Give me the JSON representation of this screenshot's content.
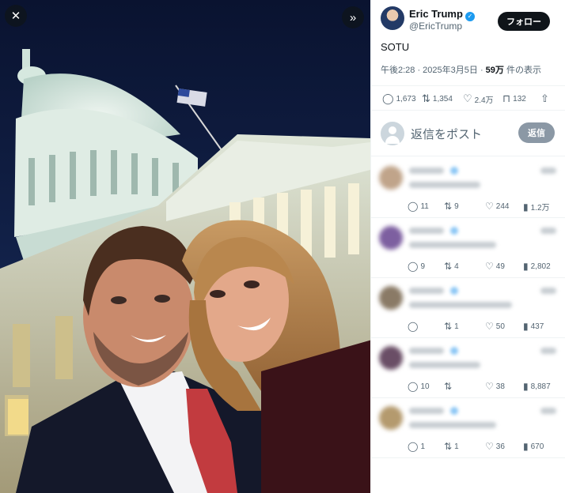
{
  "viewer": {
    "close_icon": "close-icon",
    "expand_icon": "double-chevron-right-icon"
  },
  "author": {
    "name": "Eric Trump",
    "handle": "@EricTrump",
    "verified": true,
    "follow_label": "フォロー"
  },
  "tweet": {
    "text": "SOTU",
    "timestamp": "午後2:28 · 2025年3月5日 · ",
    "views_count": "59万",
    "views_suffix": " 件の表示"
  },
  "actions": {
    "replies": "1,673",
    "reposts": "1,354",
    "likes": "2.4万",
    "bookmarks": "132"
  },
  "compose": {
    "placeholder": "返信をポスト",
    "reply_label": "返信"
  },
  "replies": [
    {
      "replies": "11",
      "reposts": "9",
      "likes": "244",
      "views": "1.2万"
    },
    {
      "replies": "9",
      "reposts": "4",
      "likes": "49",
      "views": "2,802"
    },
    {
      "replies": "",
      "reposts": "1",
      "likes": "50",
      "views": "437"
    },
    {
      "replies": "10",
      "reposts": "",
      "likes": "38",
      "views": "8,887"
    },
    {
      "replies": "1",
      "reposts": "1",
      "likes": "36",
      "views": "670"
    }
  ],
  "colors": {
    "accent": "#1d9bf0",
    "follow_bg": "#0f1419",
    "sky": "#0a1330"
  }
}
